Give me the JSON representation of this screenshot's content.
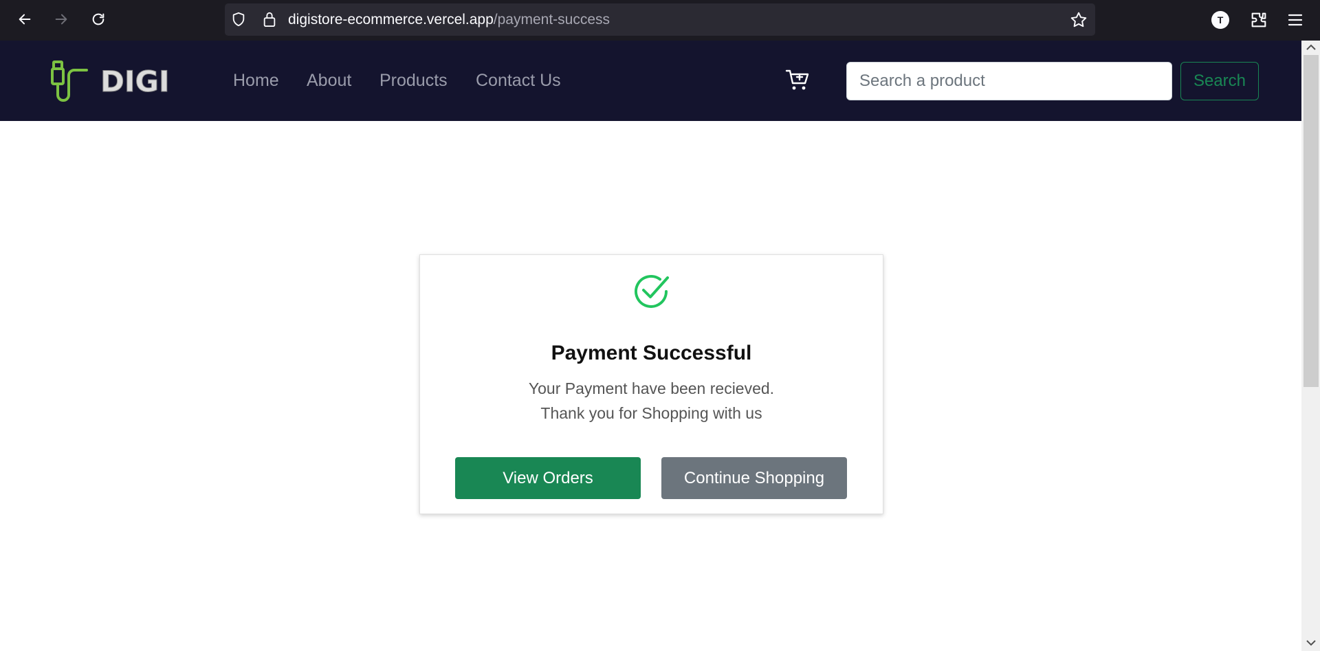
{
  "browser": {
    "url_host": "digistore-ecommerce.vercel.app",
    "url_path": "/payment-success",
    "profile_initial": "T",
    "icons": [
      "back-icon",
      "forward-icon",
      "reload-icon",
      "shield-icon",
      "lock-icon",
      "star-icon",
      "extensions-icon",
      "menu-icon"
    ]
  },
  "header": {
    "logo_text": "DIGI",
    "nav": [
      {
        "label": "Home"
      },
      {
        "label": "About"
      },
      {
        "label": "Products"
      },
      {
        "label": "Contact Us"
      }
    ],
    "search": {
      "placeholder": "Search a product",
      "value": "",
      "button_label": "Search"
    },
    "colors": {
      "background": "#14142e",
      "accent": "#198754",
      "logo_green": "#7cc242"
    }
  },
  "card": {
    "title": "Payment Successful",
    "line1": "Your Payment have been recieved.",
    "line2": "Thank you for Shopping with us",
    "primary_button": "View Orders",
    "secondary_button": "Continue Shopping",
    "colors": {
      "success": "#22c55e",
      "primary": "#198754",
      "secondary": "#6c757d"
    }
  }
}
